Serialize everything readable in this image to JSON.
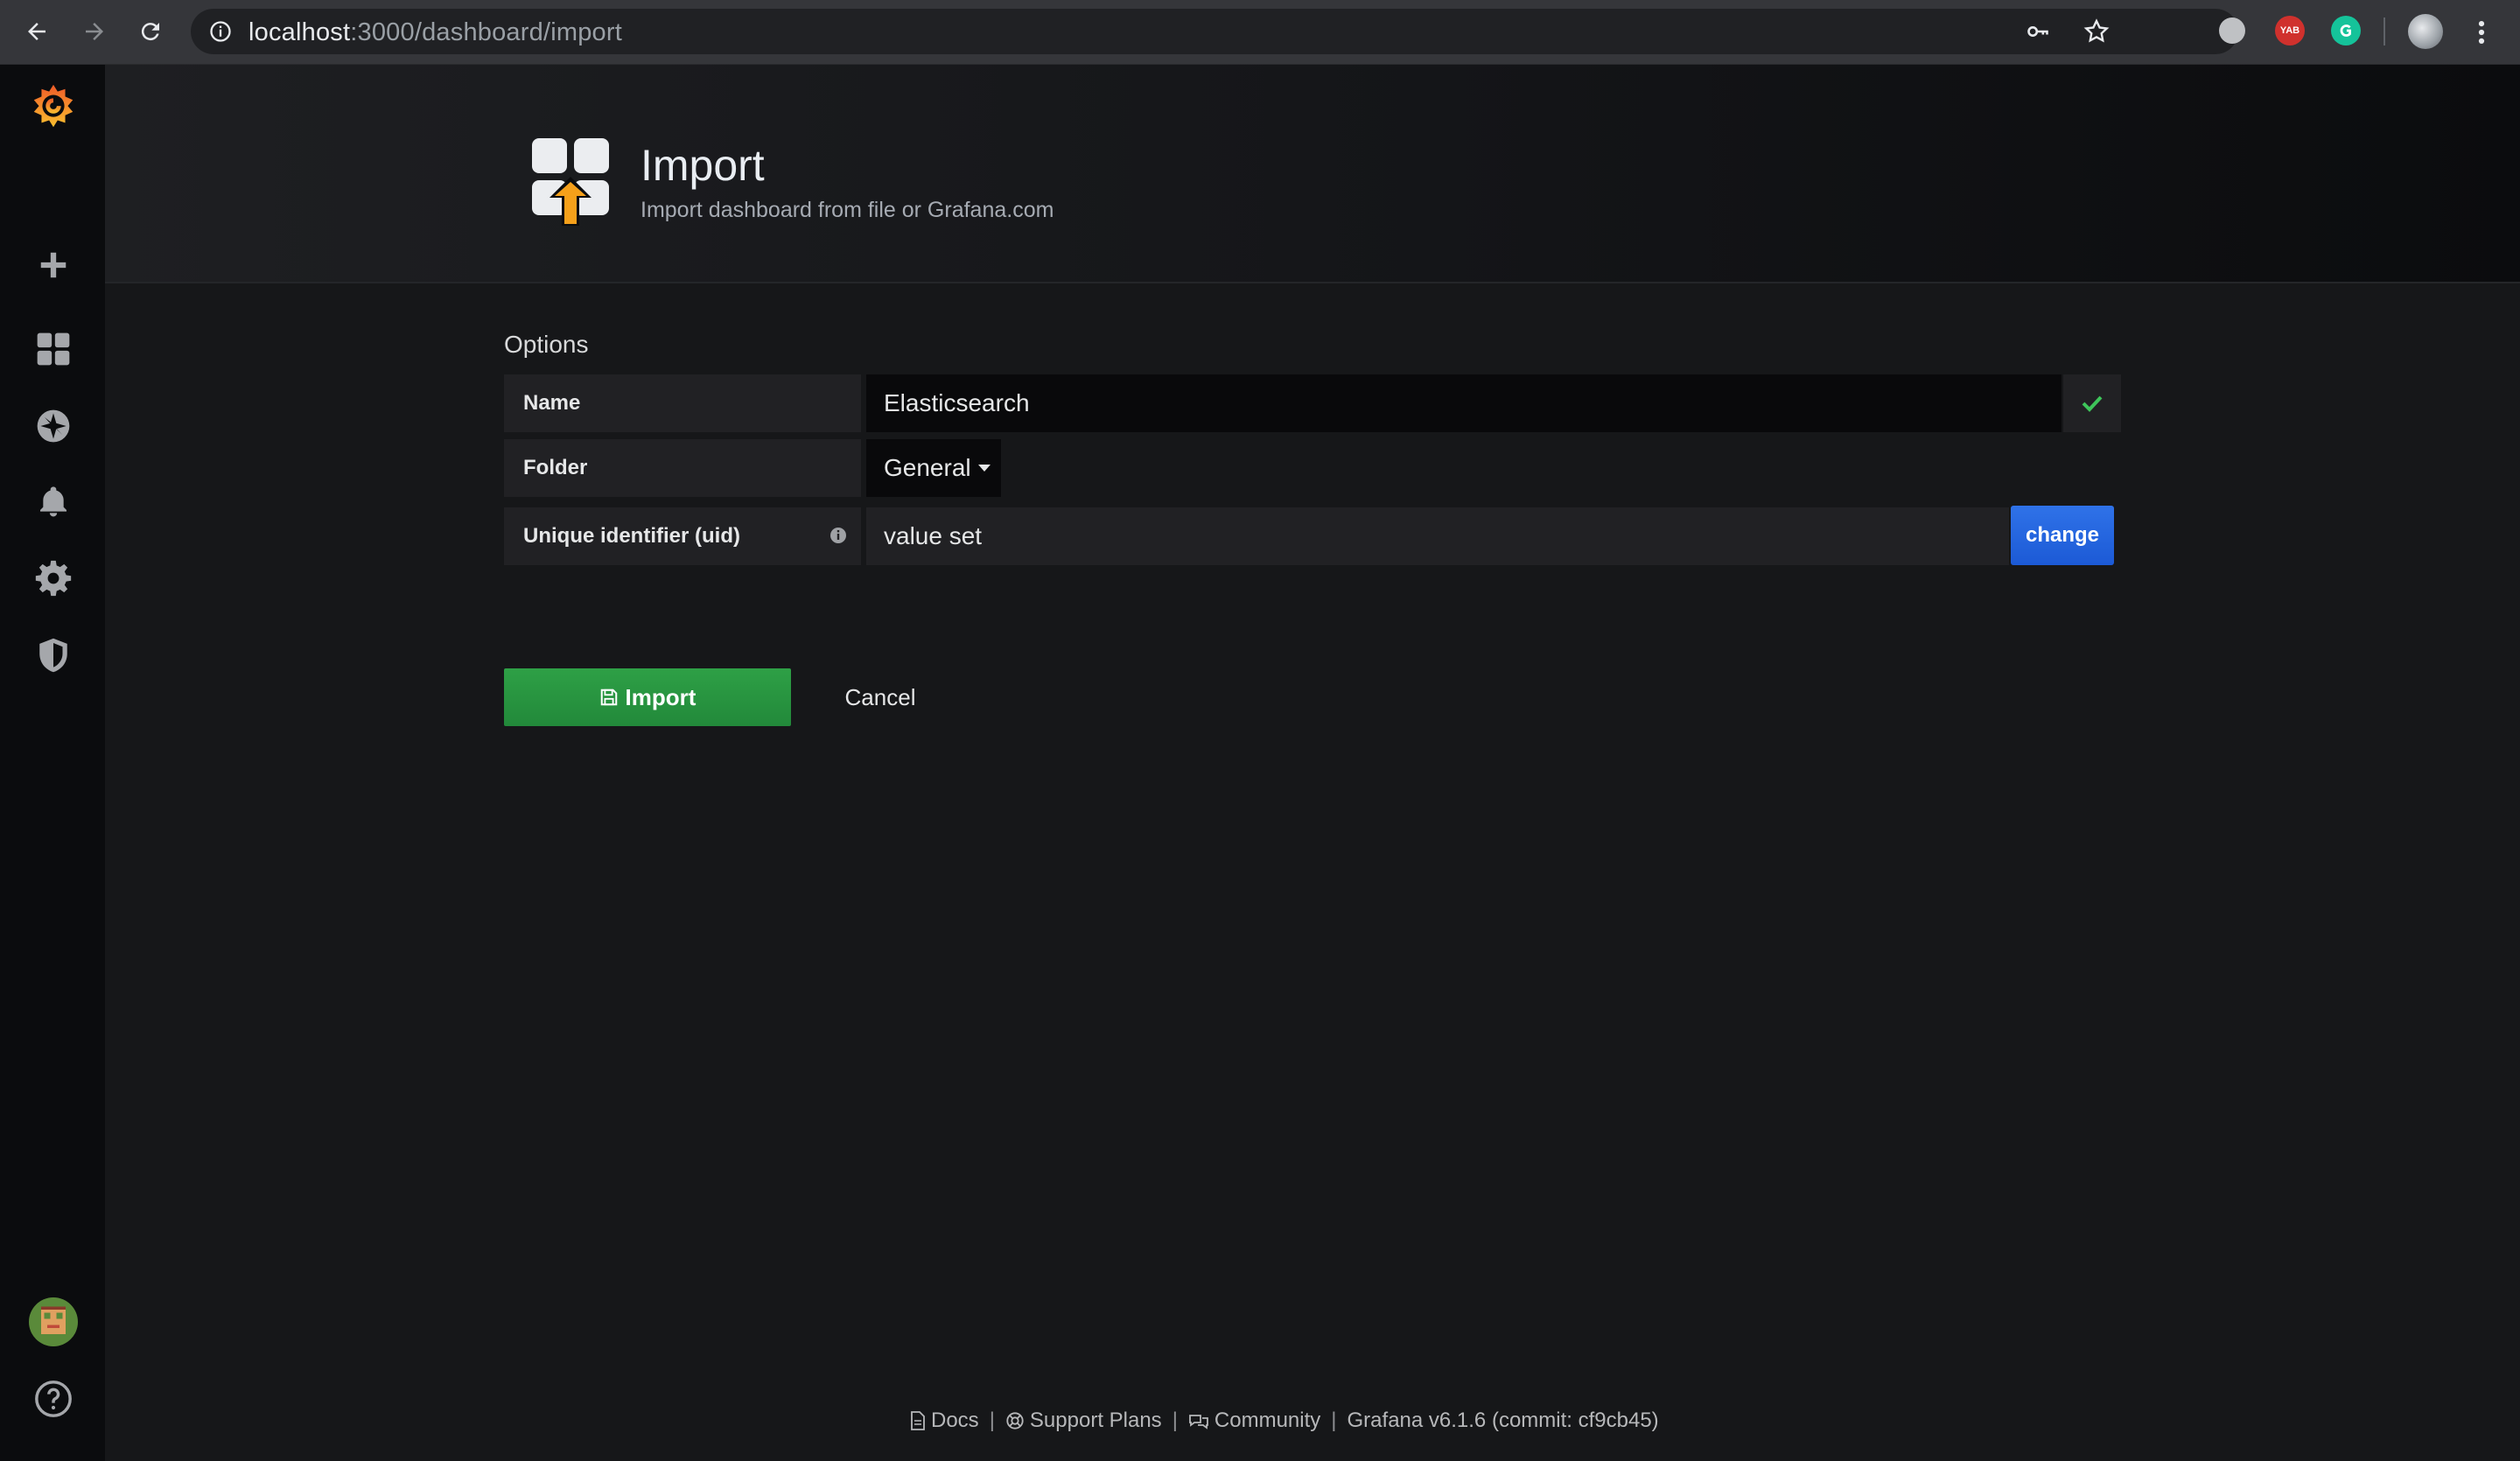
{
  "browser": {
    "url_host": "localhost",
    "url_path": ":3000/dashboard/import",
    "extension_badge": "YAB"
  },
  "sidebar": {
    "items": [
      {
        "name": "create",
        "icon": "plus-icon"
      },
      {
        "name": "dashboards",
        "icon": "grid-icon"
      },
      {
        "name": "explore",
        "icon": "compass-icon"
      },
      {
        "name": "alerting",
        "icon": "bell-icon"
      },
      {
        "name": "configuration",
        "icon": "gear-icon"
      },
      {
        "name": "server-admin",
        "icon": "shield-icon"
      }
    ],
    "bottom": [
      {
        "name": "profile",
        "icon": "avatar"
      },
      {
        "name": "help",
        "icon": "help-icon"
      }
    ]
  },
  "header": {
    "title": "Import",
    "subtitle": "Import dashboard from file or Grafana.com"
  },
  "form": {
    "section_title": "Options",
    "name_label": "Name",
    "name_value": "Elasticsearch",
    "folder_label": "Folder",
    "folder_value": "General",
    "uid_label": "Unique identifier (uid)",
    "uid_value": "value set",
    "change_label": "change",
    "import_label": "Import",
    "cancel_label": "Cancel"
  },
  "footer": {
    "docs": "Docs",
    "support": "Support Plans",
    "community": "Community",
    "version": "Grafana v6.1.6 (commit: cf9cb45)",
    "separator": "|"
  },
  "colors": {
    "accent_green": "#22893a",
    "accent_blue": "#1f62e0",
    "check_green": "#3ec55a",
    "grafana_orange": "#f46800"
  }
}
